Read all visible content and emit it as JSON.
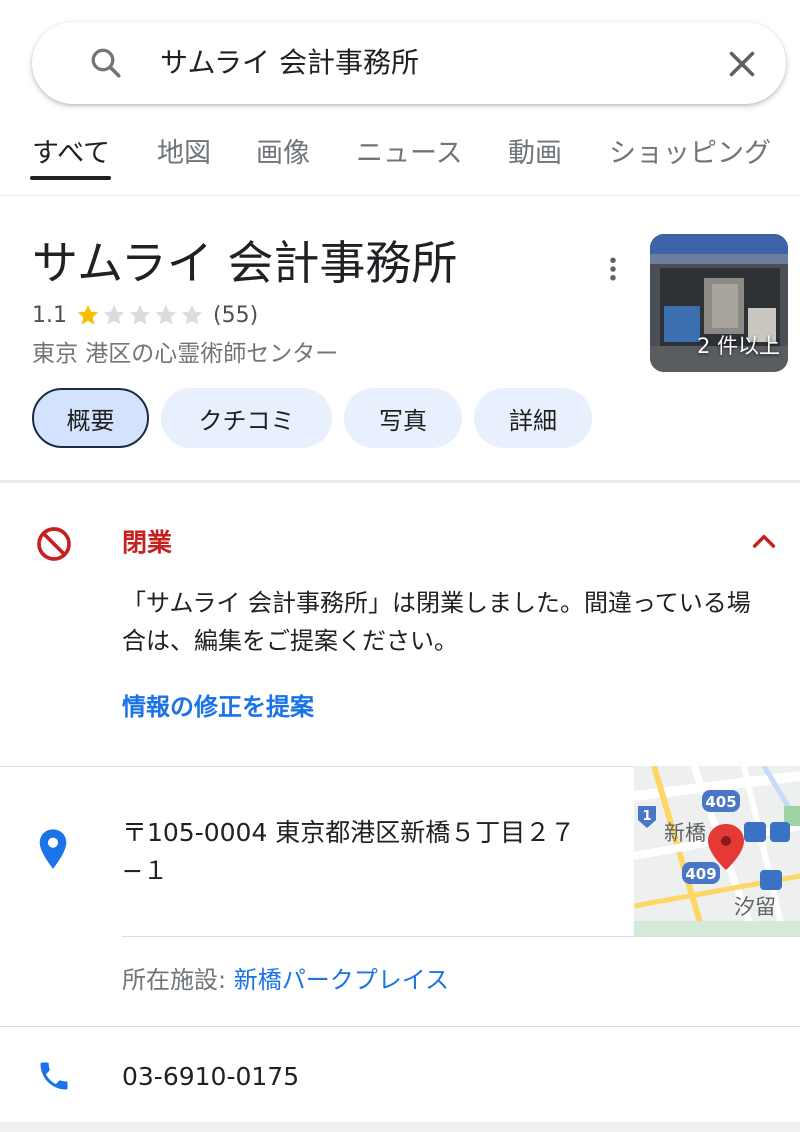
{
  "search": {
    "query": "サムライ 会計事務所"
  },
  "tabs": [
    {
      "label": "すべて",
      "active": true
    },
    {
      "label": "地図"
    },
    {
      "label": "画像"
    },
    {
      "label": "ニュース"
    },
    {
      "label": "動画"
    },
    {
      "label": "ショッピング"
    }
  ],
  "place": {
    "title": "サムライ 会計事務所",
    "rating": "1.1",
    "rating_stars": 1.1,
    "review_count": "(55)",
    "category": "東京 港区の心霊術師センター",
    "photo_count": "2 件以上"
  },
  "chips": [
    {
      "label": "概要",
      "selected": true
    },
    {
      "label": "クチコミ"
    },
    {
      "label": "写真"
    },
    {
      "label": "詳細"
    }
  ],
  "closed": {
    "label": "閉業",
    "message": "「サムライ 会計事務所」は閉業しました。間違っている場合は、編集をご提案ください。",
    "suggest_link": "情報の修正を提案"
  },
  "address": {
    "text": "〒105-0004 東京都港区新橋５丁目２７−１",
    "map_labels": {
      "road_405": "405",
      "road_409": "409",
      "road_1": "1",
      "shinbashi": "新橋",
      "shiodome": "汐留"
    }
  },
  "facility": {
    "label": "所在施設: ",
    "link": "新橋パークプレイス"
  },
  "phone": "03-6910-0175",
  "colors": {
    "accent_blue": "#1a73e8",
    "closed_red": "#c5221f",
    "star_yellow": "#fbbc04",
    "chip_bg": "#e8f0fe"
  }
}
